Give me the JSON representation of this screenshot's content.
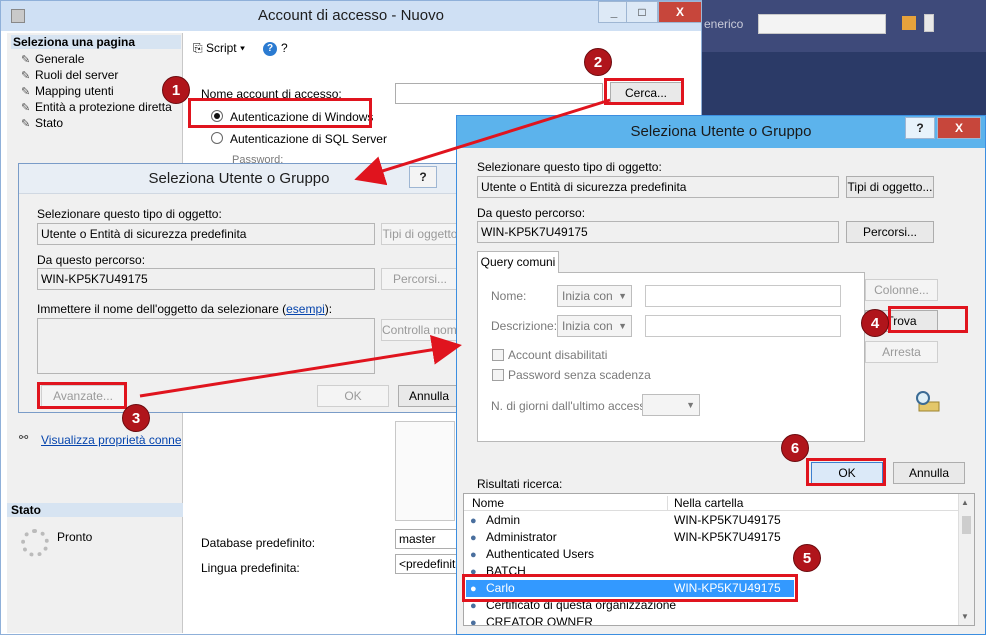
{
  "vs": {
    "combo_text": "enerico"
  },
  "main": {
    "title": "Account di accesso - Nuovo",
    "buttons": {
      "min": "_",
      "max": "□",
      "close": "X"
    },
    "sidebar": {
      "header": "Seleziona una pagina",
      "items": [
        "Generale",
        "Ruoli del server",
        "Mapping utenti",
        "Entità a protezione diretta",
        "Stato"
      ],
      "connection_link": "Visualizza proprietà connessione",
      "status_header": "Stato",
      "status_text": "Pronto"
    },
    "toolbar": {
      "script": "Script",
      "help": "?"
    },
    "login_label": "Nome account di accesso:",
    "search_button": "Cerca...",
    "auth_windows": "Autenticazione di Windows",
    "auth_sql": "Autenticazione di SQL Server",
    "password_label": "Password:",
    "default_db_label": "Database predefinito:",
    "default_db_value": "master",
    "default_lang_label": "Lingua predefinita:",
    "default_lang_value": "<predefinita>"
  },
  "dialog1": {
    "title": "Seleziona Utente o Gruppo",
    "help": "?",
    "obj_type_label": "Selezionare questo tipo di oggetto:",
    "obj_type_value": "Utente o Entità di sicurezza predefinita",
    "obj_type_button": "Tipi di oggetto",
    "location_label": "Da questo percorso:",
    "location_value": "WIN-KP5K7U49175",
    "location_button": "Percorsi...",
    "names_label": "Immettere il nome dell'oggetto da selezionare (",
    "names_link": "esempi",
    "names_label_end": "):",
    "check_button": "Controlla nomi",
    "advanced_button": "Avanzate...",
    "ok": "OK",
    "cancel": "Annulla"
  },
  "dialog2": {
    "title": "Seleziona Utente o Gruppo",
    "help": "?",
    "close": "X",
    "obj_type_label": "Selezionare questo tipo di oggetto:",
    "obj_type_value": "Utente o Entità di sicurezza predefinita",
    "obj_type_button": "Tipi di oggetto...",
    "location_label": "Da questo percorso:",
    "location_value": "WIN-KP5K7U49175",
    "location_button": "Percorsi...",
    "tab": "Query comuni",
    "name_label": "Nome:",
    "name_mode": "Inizia con",
    "desc_label": "Descrizione:",
    "desc_mode": "Inizia con",
    "disabled_accounts": "Account disabilitati",
    "no_expire": "Password senza scadenza",
    "days_label": "N. di giorni dall'ultimo accesso:",
    "columns_button": "Colonne...",
    "find_button": "Trova",
    "stop_button": "Arresta",
    "ok": "OK",
    "cancel": "Annulla",
    "results_label": "Risultati ricerca:",
    "col_name": "Nome",
    "col_folder": "Nella cartella",
    "results": [
      {
        "name": "Admin",
        "folder": "WIN-KP5K7U49175"
      },
      {
        "name": "Administrator",
        "folder": "WIN-KP5K7U49175"
      },
      {
        "name": "Authenticated Users",
        "folder": ""
      },
      {
        "name": "BATCH",
        "folder": ""
      },
      {
        "name": "Carlo",
        "folder": "WIN-KP5K7U49175"
      },
      {
        "name": "Certificato di questa organizzazione",
        "folder": ""
      },
      {
        "name": "CREATOR OWNER",
        "folder": ""
      }
    ]
  },
  "steps": [
    "1",
    "2",
    "3",
    "4",
    "5",
    "6"
  ],
  "colors": {
    "annotation_red": "#e0141e",
    "badge_red": "#b0151b",
    "selection_blue": "#3399ff"
  }
}
